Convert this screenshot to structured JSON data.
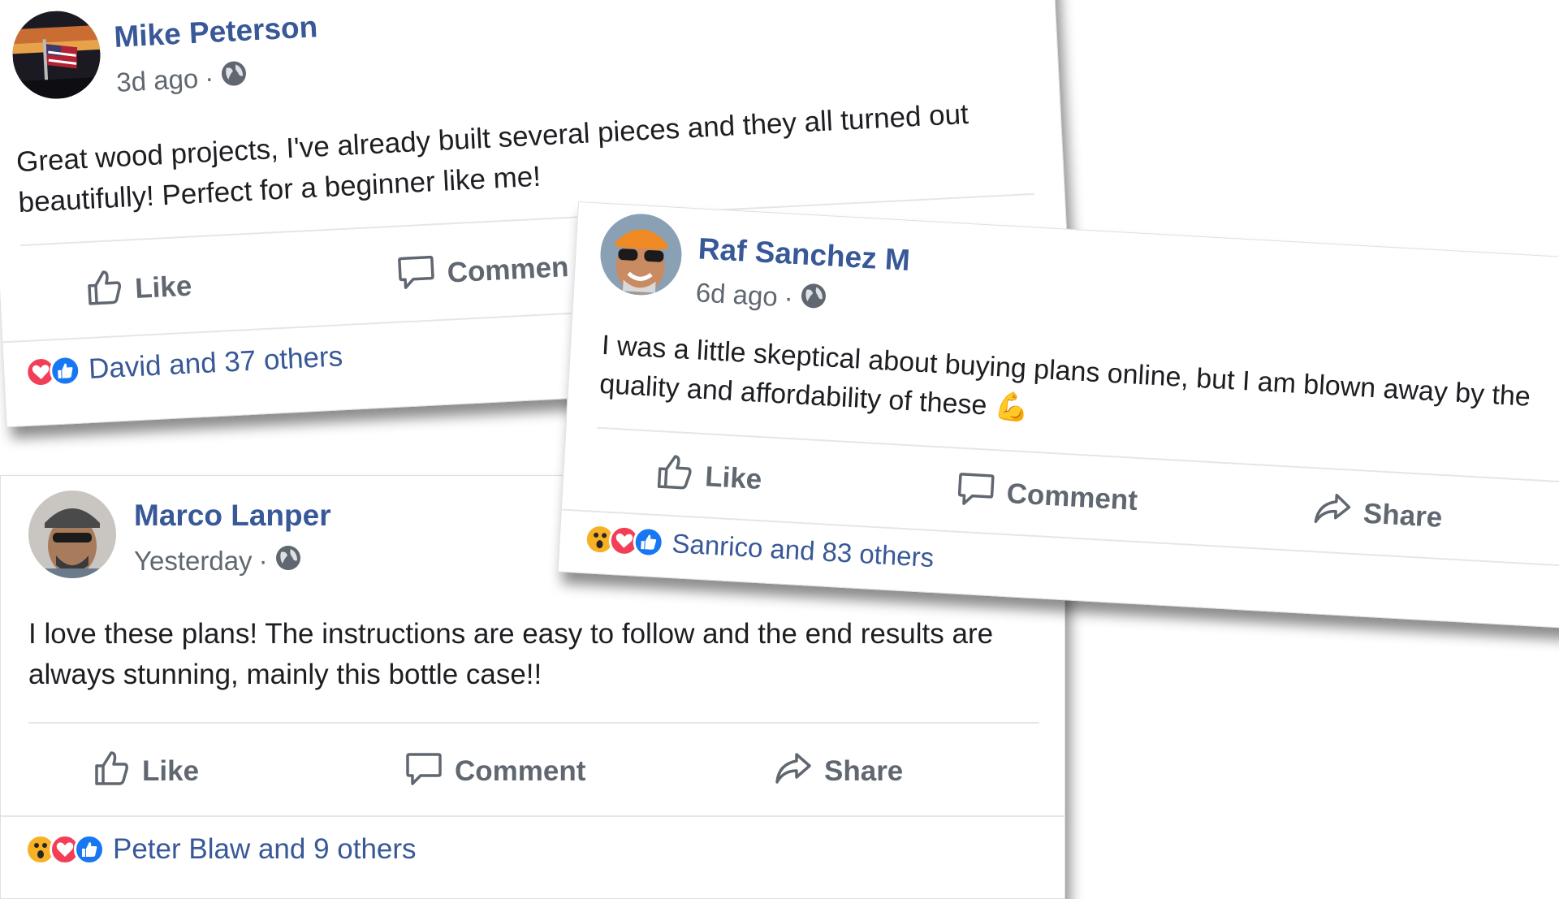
{
  "posts": [
    {
      "author": "Mike Peterson",
      "time": "3d ago",
      "separator": "·",
      "text": "Great wood projects, I've already built several pieces and they all turned out beautifully! Perfect for a beginner like me!",
      "actions": {
        "like": "Like",
        "comment": "Commen"
      },
      "reactions": {
        "icons": [
          "heart-icon",
          "like-reaction-icon"
        ],
        "summary": "David and 37 others"
      }
    },
    {
      "author": "Raf Sanchez M",
      "time": "6d ago",
      "separator": "·",
      "text": "I was a little skeptical about buying plans online, but I am blown away by the quality and affordability of these",
      "emoji": "💪",
      "actions": {
        "like": "Like",
        "comment": "Comment",
        "share": "Share"
      },
      "reactions": {
        "icons": [
          "wow-icon",
          "heart-icon",
          "like-reaction-icon"
        ],
        "summary": "Sanrico and 83 others"
      }
    },
    {
      "author": "Marco Lanper",
      "time": "Yesterday",
      "separator": "·",
      "text": "I love these plans! The instructions are easy to follow and the end results are always stunning, mainly this bottle case!!",
      "actions": {
        "like": "Like",
        "comment": "Comment",
        "share": "Share"
      },
      "reactions": {
        "icons": [
          "wow-icon",
          "heart-icon",
          "like-reaction-icon"
        ],
        "summary": "Peter Blaw and 9 others"
      }
    }
  ],
  "colors": {
    "name": "#385898",
    "meta": "#606770",
    "text": "#1c1e21",
    "like_blue": "#1877f2",
    "heart_red": "#f33e58",
    "wow_yellow": "#f7b125"
  }
}
